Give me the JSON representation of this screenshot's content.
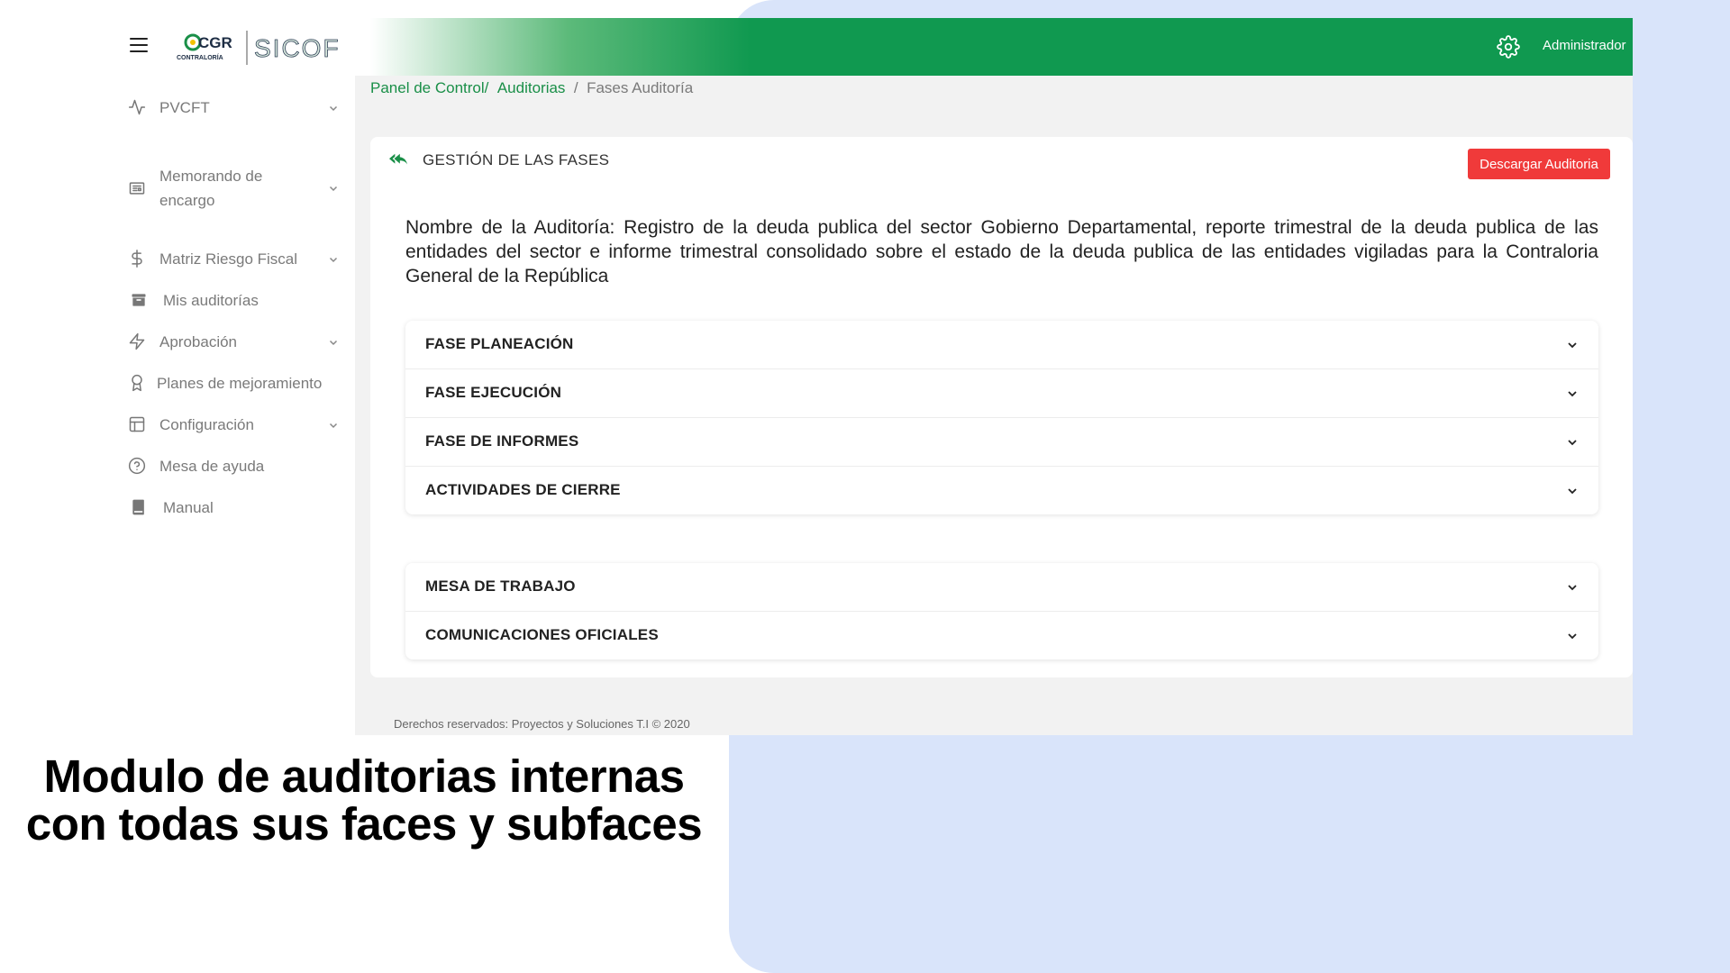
{
  "app": {
    "logo_primary": "CGR",
    "logo_secondary": "CONTRALORÍA",
    "logo_brand": "SICOF",
    "user": "Administrador"
  },
  "sidebar": {
    "items": [
      {
        "label": "PVCFT",
        "icon": "activity-icon",
        "expandable": true
      },
      {
        "label": "Memorando de encargo",
        "icon": "newspaper-icon",
        "expandable": true
      },
      {
        "label": "Matriz Riesgo Fiscal",
        "icon": "dollar-icon",
        "expandable": true
      },
      {
        "label": "Mis auditorías",
        "icon": "archive-icon",
        "expandable": false
      },
      {
        "label": "Aprobación",
        "icon": "lightning-icon",
        "expandable": true
      },
      {
        "label": "Planes de mejoramiento",
        "icon": "award-icon",
        "expandable": false
      },
      {
        "label": "Configuración",
        "icon": "layout-icon",
        "expandable": true
      },
      {
        "label": "Mesa de ayuda",
        "icon": "help-circle-icon",
        "expandable": false
      },
      {
        "label": "Manual",
        "icon": "book-icon",
        "expandable": false
      }
    ]
  },
  "breadcrumb": {
    "home": "Panel de Control",
    "sep1": "/",
    "section": "Auditorias",
    "sep2": "/",
    "current": "Fases Auditoría"
  },
  "card": {
    "title": "GESTIÓN DE LAS FASES",
    "download_label": "Descargar Auditoria",
    "audit_name": "Nombre de la Auditoría: Registro de la deuda publica del sector Gobierno Departamental, reporte trimestral de la deuda publica de las entidades del sector e informe trimestral consolidado sobre el estado de la deuda publica de las entidades vigiladas para la Contraloria General de la República"
  },
  "phases": [
    "FASE PLANEACIÓN",
    "FASE EJECUCIÓN",
    "FASE DE INFORMES",
    "ACTIVIDADES DE CIERRE"
  ],
  "extra_sections": [
    "MESA DE TRABAJO",
    "COMUNICACIONES OFICIALES"
  ],
  "footer": "Derechos reservados: Proyectos y Soluciones T.I © 2020",
  "caption": {
    "line1": "Modulo de auditorias internas",
    "line2": "con todas sus faces y subfaces"
  },
  "colors": {
    "brand_green": "#109950",
    "link_green": "#1a8f48",
    "danger": "#f03a3a",
    "backdrop": "#d9e4fa"
  }
}
